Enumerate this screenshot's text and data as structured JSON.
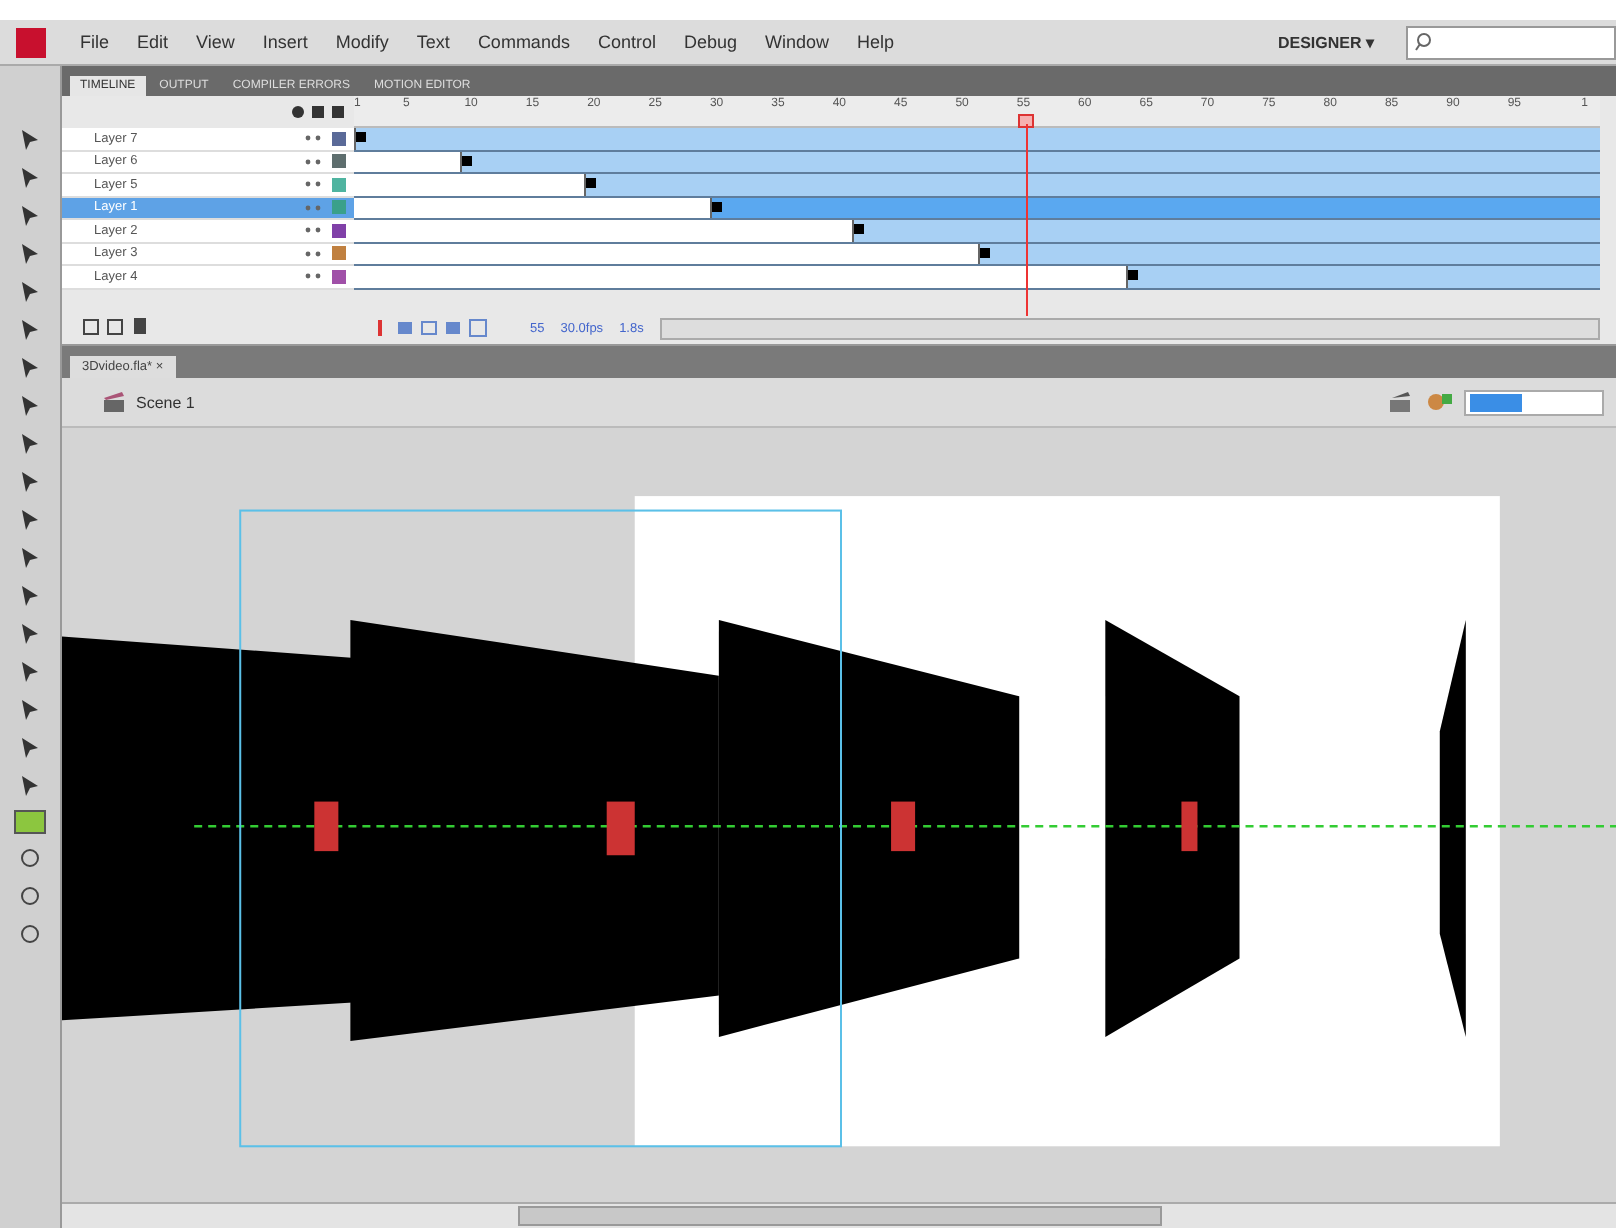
{
  "menu": [
    "File",
    "Edit",
    "View",
    "Insert",
    "Modify",
    "Text",
    "Commands",
    "Control",
    "Debug",
    "Window",
    "Help"
  ],
  "workspace": {
    "label": "DESIGNER",
    "caret": "▾"
  },
  "panel_tabs": [
    {
      "label": "TIMELINE",
      "selected": true
    },
    {
      "label": "OUTPUT",
      "selected": false
    },
    {
      "label": "COMPILER ERRORS",
      "selected": false
    },
    {
      "label": "MOTION EDITOR",
      "selected": false
    }
  ],
  "ruler": [
    "1",
    "5",
    "10",
    "15",
    "20",
    "25",
    "30",
    "35",
    "40",
    "45",
    "50",
    "55",
    "60",
    "65",
    "70",
    "75",
    "80",
    "85",
    "90",
    "95",
    "1"
  ],
  "playhead": {
    "level": 0.54
  },
  "layers": [
    {
      "name": "Layer 7",
      "selected": false,
      "color": "#5a6a98",
      "level": 0
    },
    {
      "name": "Layer 6",
      "selected": false,
      "color": "#5e6e6e",
      "level": 0.085
    },
    {
      "name": "Layer 5",
      "selected": false,
      "color": "#4fb4a0",
      "level": 0.185
    },
    {
      "name": "Layer 1",
      "selected": true,
      "color": "#3aa08a",
      "level": 0.286
    },
    {
      "name": "Layer 2",
      "selected": false,
      "color": "#8040a8",
      "level": 0.4
    },
    {
      "name": "Layer 3",
      "selected": false,
      "color": "#c08040",
      "level": 0.5
    },
    {
      "name": "Layer 4",
      "selected": false,
      "color": "#a050a8",
      "level": 0.62
    }
  ],
  "timeline_footer": {
    "frame": "55",
    "fps": "30.0fps",
    "time": "1.8s"
  },
  "document_tab": {
    "title": "3Dvideo.fla*",
    "close": "×"
  },
  "scene": {
    "label": "Scene 1"
  }
}
